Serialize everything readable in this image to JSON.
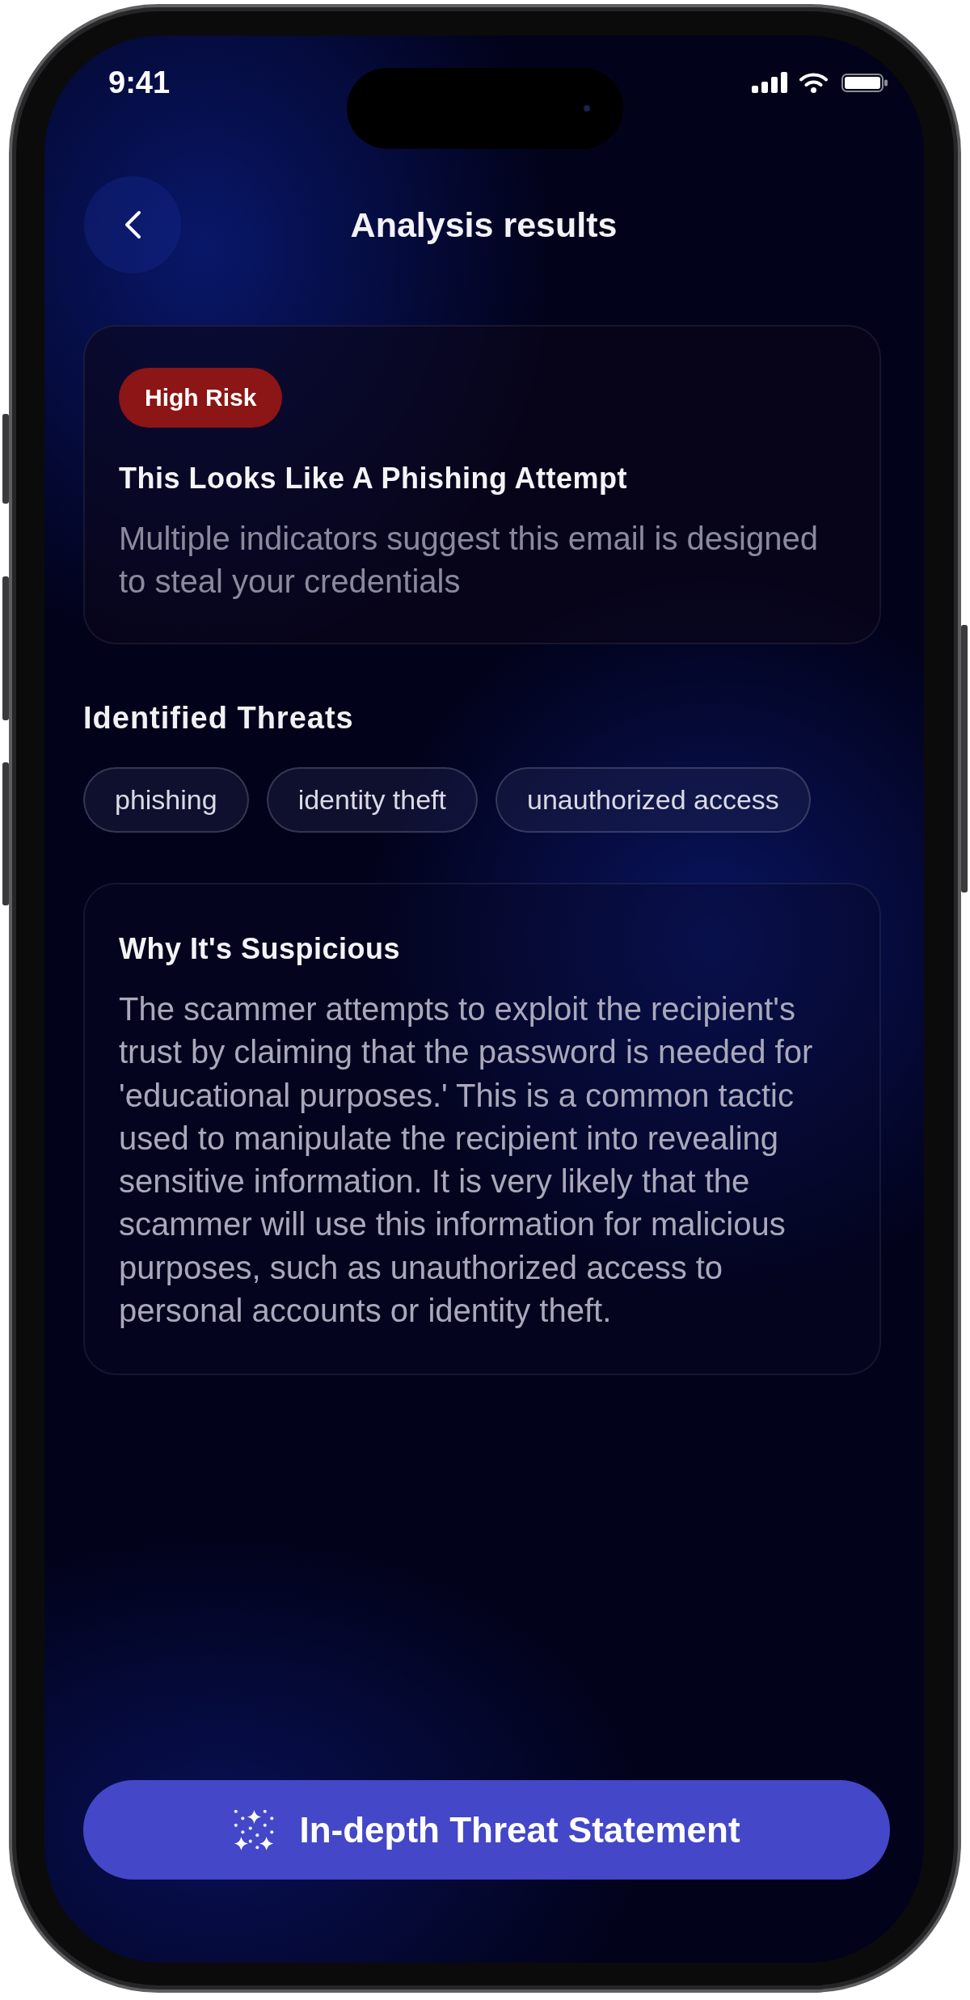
{
  "status_bar": {
    "time": "9:41"
  },
  "header": {
    "title": "Analysis results"
  },
  "risk_card": {
    "badge": "High Risk",
    "title": "This Looks Like A Phishing Attempt",
    "description": "Multiple indicators suggest this email is designed to steal your credentials"
  },
  "threats": {
    "heading": "Identified Threats",
    "tags": [
      "phishing",
      "identity theft",
      "unauthorized access"
    ]
  },
  "explanation_card": {
    "title": "Why It's Suspicious",
    "body": "The scammer attempts to exploit the recipient's trust by claiming that the password is needed for 'educational purposes.' This is a common tactic used to manipulate the recipient into revealing sensitive information. It is very likely that the scammer will use this information for malicious purposes, such as unauthorized access to personal accounts or identity theft."
  },
  "action_button": {
    "label": "In-depth Threat Statement"
  }
}
